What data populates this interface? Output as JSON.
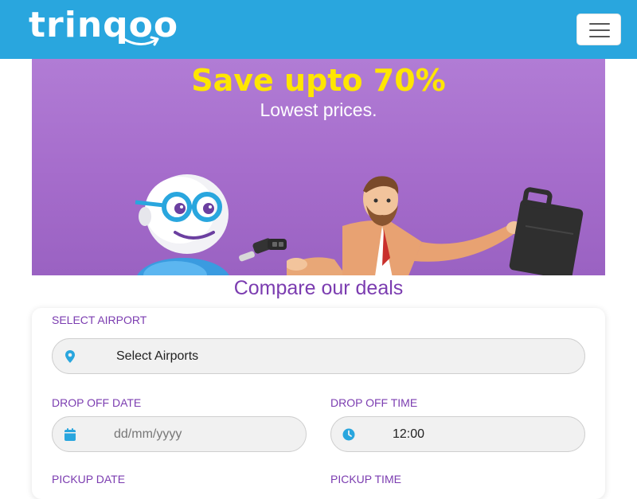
{
  "navbar": {
    "brand": "trinqoo",
    "menu_toggle": "toggle-navigation"
  },
  "banner": {
    "headline": "Save upto 70%",
    "subline": "Lowest prices."
  },
  "deals": {
    "title": "Compare our deals"
  },
  "form": {
    "airport": {
      "label": "SELECT AIRPORT",
      "value": "Select Airports",
      "icon": "location-pin-icon"
    },
    "dropoff_date": {
      "label": "DROP OFF DATE",
      "placeholder": "dd/mm/yyyy",
      "icon": "calendar-icon"
    },
    "dropoff_time": {
      "label": "DROP OFF TIME",
      "value": "12:00",
      "icon": "clock-icon"
    },
    "pickup_date": {
      "label": "PICKUP DATE"
    },
    "pickup_time": {
      "label": "PICKUP TIME"
    }
  },
  "colors": {
    "navbar": "#29a6de",
    "accent": "#7b3cb0",
    "headline": "#ffe600",
    "icon": "#29a6de"
  }
}
